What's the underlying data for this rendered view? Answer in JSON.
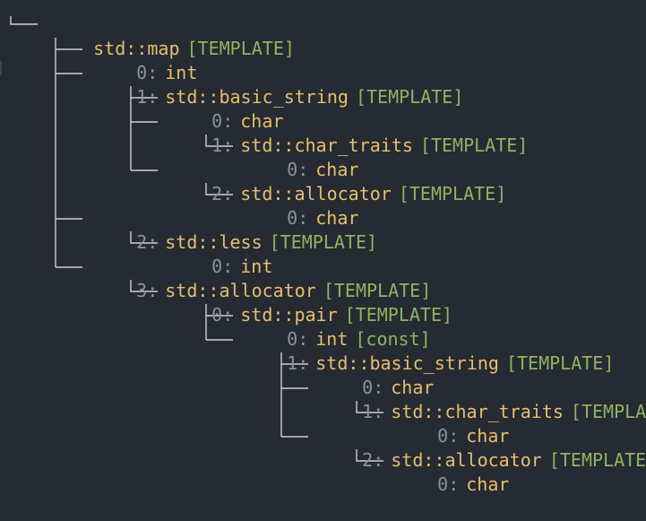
{
  "tree": {
    "root": {
      "type": "std::map",
      "tag": "[TEMPLATE]"
    },
    "nodes": [
      {
        "index": "0:",
        "type": "int",
        "tag": ""
      },
      {
        "index": "1:",
        "type": "std::basic_string",
        "tag": "[TEMPLATE]"
      },
      {
        "index": "0:",
        "type": "char",
        "tag": ""
      },
      {
        "index": "1:",
        "type": "std::char_traits",
        "tag": "[TEMPLATE]"
      },
      {
        "index": "0:",
        "type": "char",
        "tag": ""
      },
      {
        "index": "2:",
        "type": "std::allocator",
        "tag": "[TEMPLATE]"
      },
      {
        "index": "0:",
        "type": "char",
        "tag": ""
      },
      {
        "index": "2:",
        "type": "std::less",
        "tag": "[TEMPLATE]"
      },
      {
        "index": "0:",
        "type": "int",
        "tag": ""
      },
      {
        "index": "3:",
        "type": "std::allocator",
        "tag": "[TEMPLATE]"
      },
      {
        "index": "0:",
        "type": "std::pair",
        "tag": "[TEMPLATE]"
      },
      {
        "index": "0:",
        "type": "int",
        "tag": "[const]"
      },
      {
        "index": "1:",
        "type": "std::basic_string",
        "tag": "[TEMPLATE]"
      },
      {
        "index": "0:",
        "type": "char",
        "tag": ""
      },
      {
        "index": "1:",
        "type": "std::char_traits",
        "tag": "[TEMPLATE]"
      },
      {
        "index": "0:",
        "type": "char",
        "tag": ""
      },
      {
        "index": "2:",
        "type": "std::allocator",
        "tag": "[TEMPLATE]"
      },
      {
        "index": "0:",
        "type": "char",
        "tag": ""
      }
    ]
  },
  "colors": {
    "background": "#252a33",
    "index": "#8d929a",
    "type": "#e8bf6a",
    "tag": "#8fb45f",
    "connector": "#d0d0d0"
  }
}
